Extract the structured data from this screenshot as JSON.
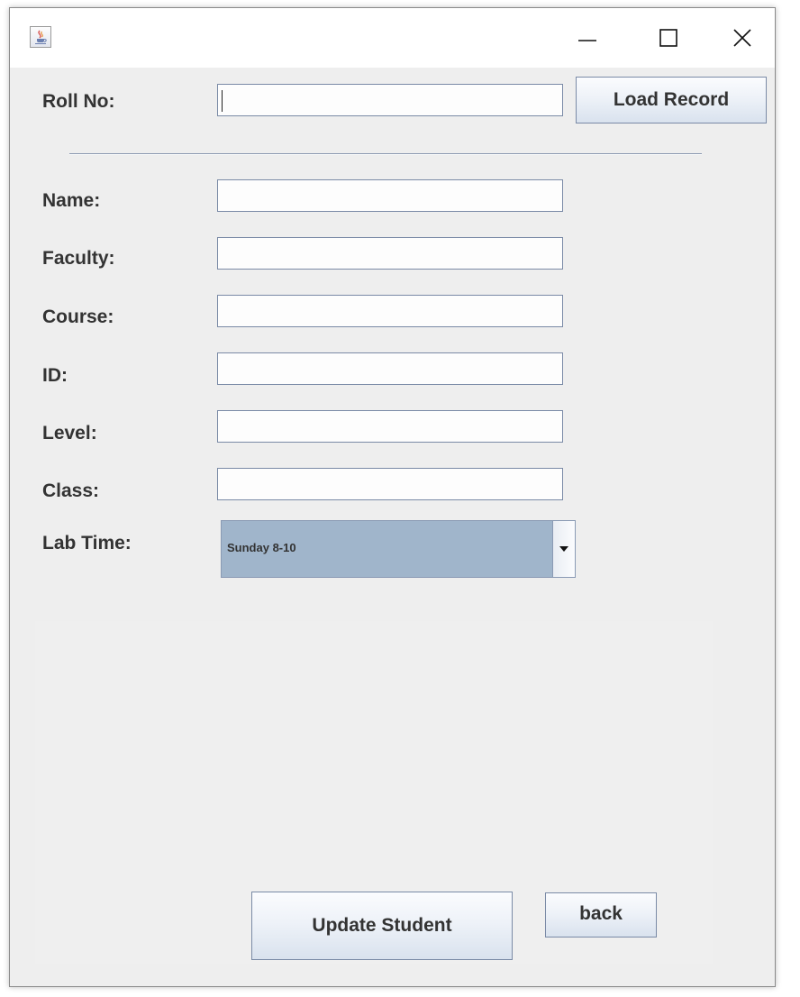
{
  "window": {
    "app_icon": "java-coffee-icon",
    "controls": [
      "minimize-icon",
      "maximize-icon",
      "close-icon"
    ]
  },
  "roll_no": {
    "label": "Roll No:",
    "value": "",
    "load_button": "Load Record"
  },
  "fields": [
    {
      "label": "Name:",
      "value": ""
    },
    {
      "label": "Faculty:",
      "value": ""
    },
    {
      "label": "Course:",
      "value": ""
    },
    {
      "label": "ID:",
      "value": ""
    },
    {
      "label": "Level:",
      "value": ""
    },
    {
      "label": "Class:",
      "value": ""
    }
  ],
  "lab_time": {
    "label": "Lab Time:",
    "selected": "Sunday 8-10"
  },
  "actions": {
    "update_button": "Update Student",
    "back_button": "back"
  },
  "colors": {
    "window_bg": "#eeeeee",
    "field_border": "#7a8aa6",
    "combo_bg": "#a0b5cb"
  }
}
